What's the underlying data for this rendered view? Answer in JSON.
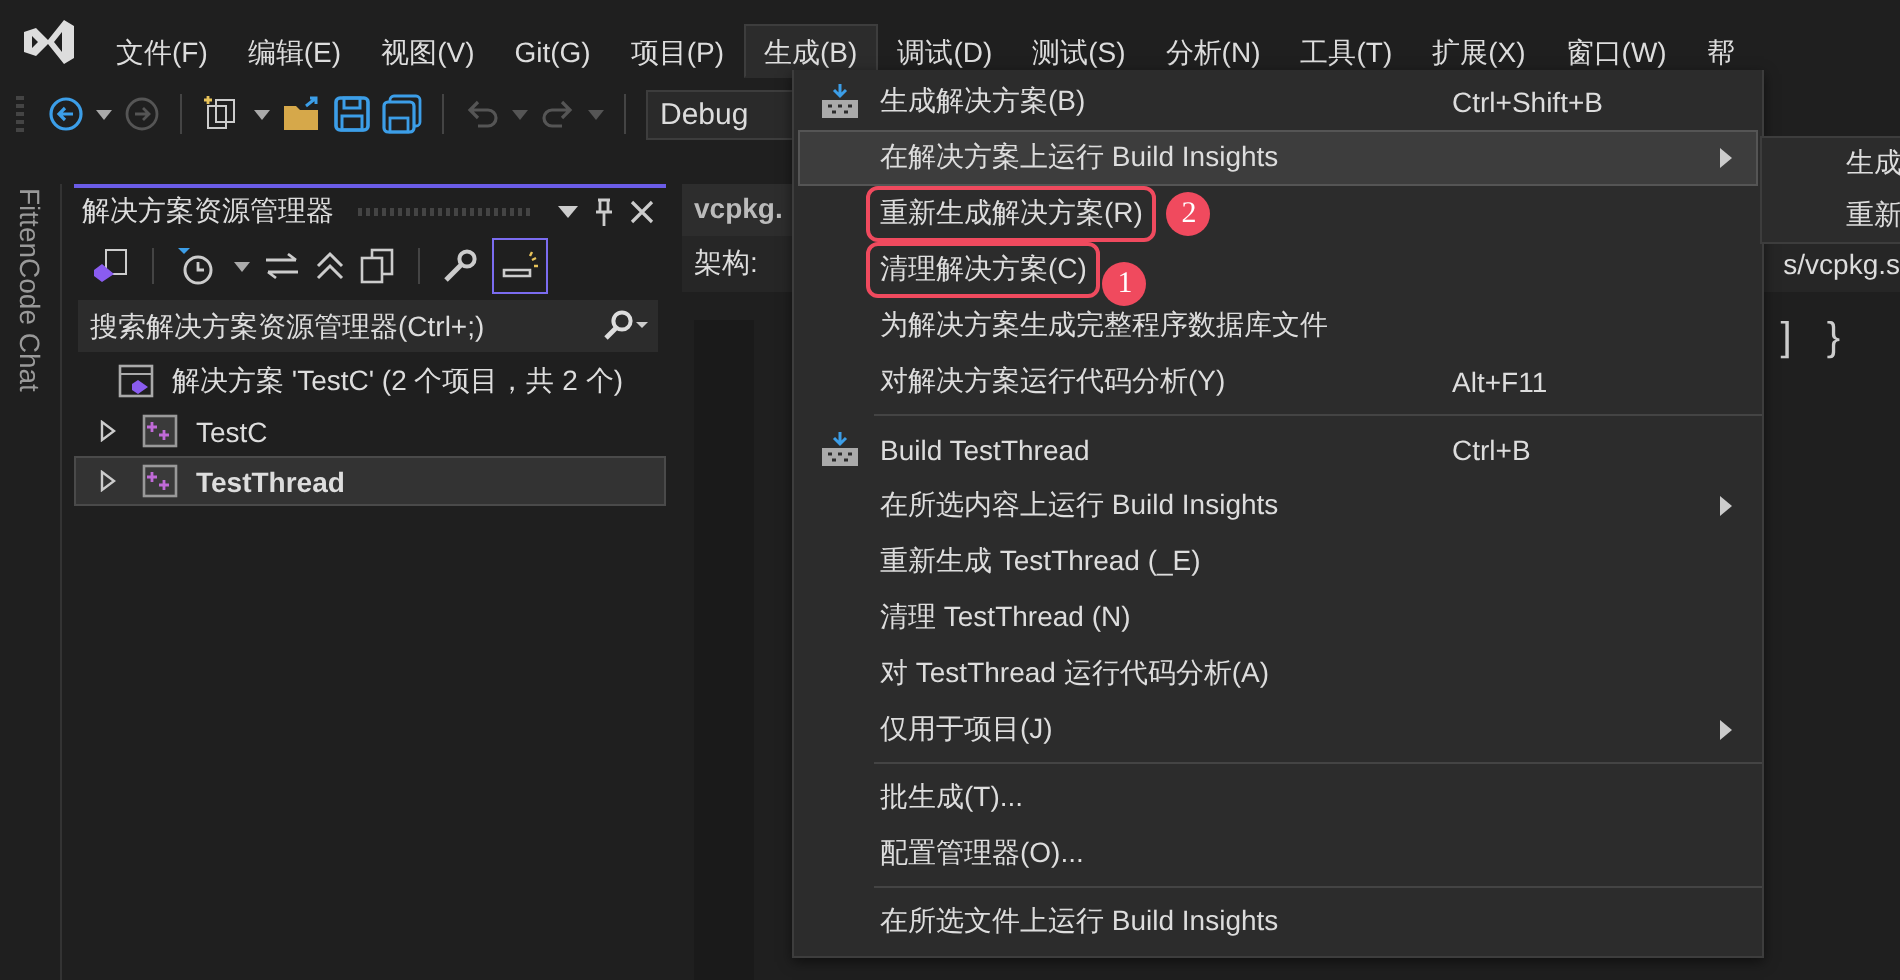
{
  "menubar": {
    "items": [
      {
        "label": "文件(F)",
        "selected": false
      },
      {
        "label": "编辑(E)",
        "selected": false
      },
      {
        "label": "视图(V)",
        "selected": false
      },
      {
        "label": "Git(G)",
        "selected": false
      },
      {
        "label": "项目(P)",
        "selected": false
      },
      {
        "label": "生成(B)",
        "selected": true
      },
      {
        "label": "调试(D)",
        "selected": false
      },
      {
        "label": "测试(S)",
        "selected": false
      },
      {
        "label": "分析(N)",
        "selected": false
      },
      {
        "label": "工具(T)",
        "selected": false
      },
      {
        "label": "扩展(X)",
        "selected": false
      },
      {
        "label": "窗口(W)",
        "selected": false
      },
      {
        "label": "帮",
        "selected": false
      }
    ]
  },
  "toolbar": {
    "configuration": "Debug"
  },
  "side_tab": {
    "label": "FittenCode Chat"
  },
  "solution_explorer": {
    "title": "解决方案资源管理器",
    "search": {
      "placeholder": "搜索解决方案资源管理器(Ctrl+;)"
    },
    "tree": [
      {
        "label": "解决方案 'TestC' (2 个项目，共 2 个)",
        "kind": "solution",
        "selected": false,
        "children": [
          {
            "label": "TestC",
            "kind": "project",
            "selected": false
          },
          {
            "label": "TestThread",
            "kind": "project",
            "selected": true
          }
        ]
      }
    ]
  },
  "editor": {
    "tab": "vcpkg.",
    "arch_label": "架构:",
    "path_fragment": "s/vcpkg.s",
    "code_fragment": "] }"
  },
  "build_menu": {
    "items": [
      {
        "kind": "build_item",
        "label": "生成解决方案(B)",
        "shortcut": "Ctrl+Shift+B",
        "submenu": false,
        "highlighted": false
      },
      {
        "kind": "item",
        "label": "在解决方案上运行 Build Insights",
        "submenu": true,
        "highlighted": true
      },
      {
        "kind": "item",
        "label": "重新生成解决方案(R)",
        "submenu": false,
        "highlighted": false,
        "annotation": "2"
      },
      {
        "kind": "item",
        "label": "清理解决方案(C)",
        "submenu": false,
        "highlighted": false,
        "annotation": "1"
      },
      {
        "kind": "item",
        "label": "为解决方案生成完整程序数据库文件",
        "submenu": false,
        "highlighted": false
      },
      {
        "kind": "item",
        "label": "对解决方案运行代码分析(Y)",
        "shortcut": "Alt+F11",
        "submenu": false,
        "highlighted": false
      },
      {
        "kind": "separator"
      },
      {
        "kind": "build_item",
        "label": "Build TestThread",
        "shortcut": "Ctrl+B",
        "submenu": false,
        "highlighted": false
      },
      {
        "kind": "item",
        "label": "在所选内容上运行 Build Insights",
        "submenu": true,
        "highlighted": false
      },
      {
        "kind": "item",
        "label": "重新生成 TestThread (_E)",
        "submenu": false,
        "highlighted": false
      },
      {
        "kind": "item",
        "label": "清理 TestThread (N)",
        "submenu": false,
        "highlighted": false
      },
      {
        "kind": "item",
        "label": "对 TestThread 运行代码分析(A)",
        "submenu": false,
        "highlighted": false
      },
      {
        "kind": "item",
        "label": "仅用于项目(J)",
        "submenu": true,
        "highlighted": false
      },
      {
        "kind": "separator"
      },
      {
        "kind": "item",
        "label": "批生成(T)...",
        "submenu": false,
        "highlighted": false
      },
      {
        "kind": "item",
        "label": "配置管理器(O)...",
        "submenu": false,
        "highlighted": false
      },
      {
        "kind": "separator"
      },
      {
        "kind": "item",
        "label": "在所选文件上运行 Build Insights",
        "submenu": false,
        "highlighted": false
      }
    ]
  },
  "submenu": {
    "items": [
      "生成",
      "重新"
    ]
  }
}
